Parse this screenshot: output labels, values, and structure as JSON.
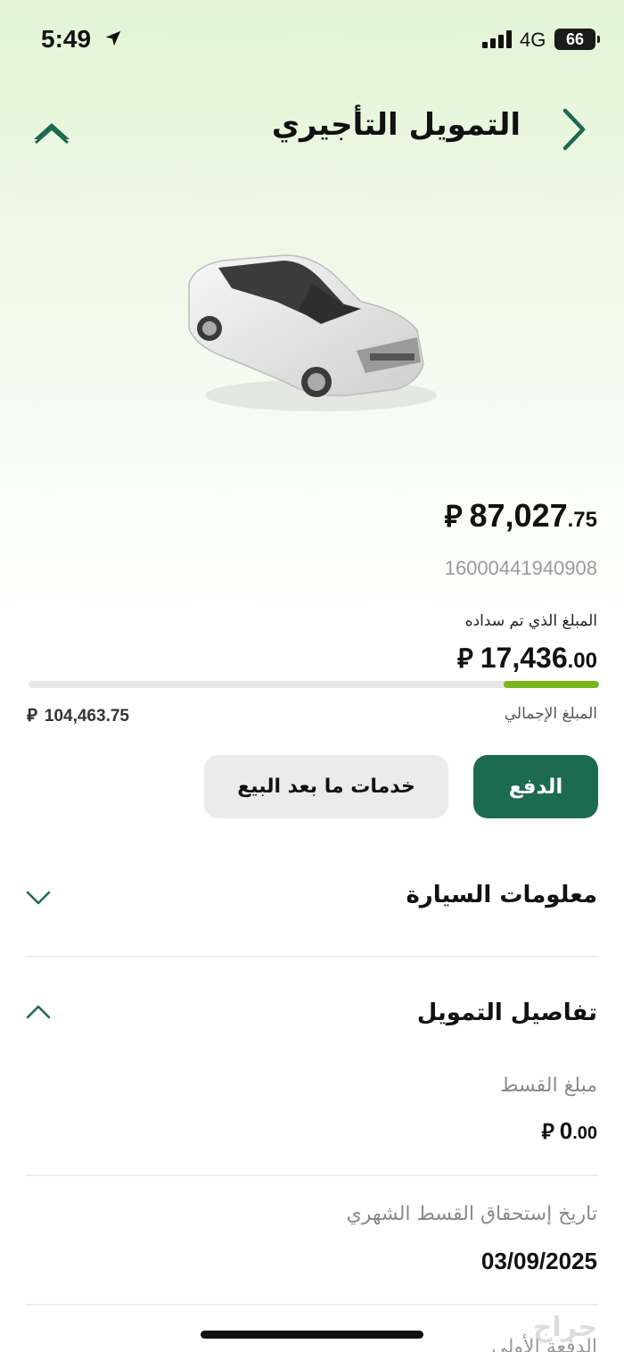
{
  "status_bar": {
    "time": "5:49",
    "network": "4G",
    "battery": "66"
  },
  "header": {
    "title": "التمويل التأجيري"
  },
  "balance": {
    "remaining_int": "87,027",
    "remaining_dec": ".75",
    "currency_symbol": "⃁",
    "contract_number": "16000441940908",
    "paid_label": "المبلغ الذي تم سداده",
    "paid_int": "17,436",
    "paid_dec": ".00",
    "progress_paid_fraction": 0.167,
    "total_label": "المبلغ الإجمالي",
    "total_amount": "104,463.75"
  },
  "actions": {
    "pay_label": "الدفع",
    "services_label": "خدمات ما بعد البيع"
  },
  "sections": {
    "car_info_title": "معلومات السيارة",
    "finance_details_title": "تفاصيل التمويل",
    "installment_label": "مبلغ القسط",
    "installment_int": "0",
    "installment_dec": ".00",
    "due_date_label": "تاريخ إستحقاق القسط الشهري",
    "due_date_value": "03/09/2025",
    "down_payment_label": "الدفعة الأولى"
  },
  "colors": {
    "brand_green": "#1c6a50",
    "progress_green": "#7ab51d"
  },
  "watermark": "حراج"
}
